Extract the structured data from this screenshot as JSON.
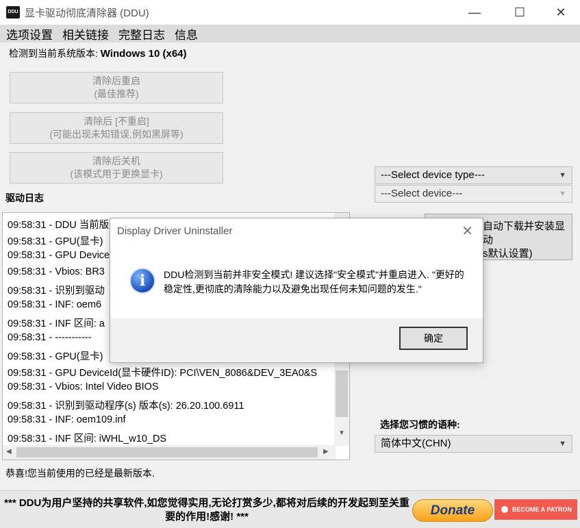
{
  "window": {
    "title": "显卡驱动彻底清除器 (DDU)",
    "app_icon_text": "DDU",
    "minimize": "—",
    "maximize": "☐",
    "close": "✕"
  },
  "menu": [
    "选项设置",
    "相关链接",
    "完整日志",
    "信息"
  ],
  "system": {
    "label": "检测到当前系统版本: ",
    "version": "Windows 10 (x64)"
  },
  "actions": [
    {
      "line1": "清除后重启",
      "line2": "(最佳推荐)"
    },
    {
      "line1": "清除后 [不重启]",
      "line2": "(可能出现未知错误,例如黑屏等)"
    },
    {
      "line1": "清除后关机",
      "line2": "(该模式用于更换显卡)"
    }
  ],
  "log": {
    "label": "驱动日志",
    "lines": [
      "09:58:31 - DDU 当前版",
      "09:58:31 - GPU(显卡)",
      "09:58:31 - GPU Device",
      "09:58:31 - Vbios: BR3",
      "09:58:31 - 识别到驱动",
      "09:58:31 - INF: oem6",
      "09:58:31 - INF 区间: a",
      "09:58:31 - -----------",
      "09:58:31 - GPU(显卡)",
      "09:58:31 - GPU DeviceId(显卡硬件ID): PCI\\VEN_8086&DEV_3EA0&S",
      "09:58:31 - Vbios: Intel Video BIOS",
      "09:58:31 - 识别到驱动程序(s) 版本(s): 26.20.100.6911",
      "09:58:31 - INF: oem109.inf",
      "09:58:31 - INF 区间: iWHL_w10_DS"
    ]
  },
  "status_message": "恭喜!您当前使用的已经是最新版本.",
  "device_type_select": "---Select device type---",
  "device_select": "---Select device---",
  "right_button": {
    "line1": "自动下载并安装显",
    "line2": "动",
    "line3": "s默认设置)"
  },
  "language": {
    "label": "选择您习惯的语种:",
    "value": "简体中文(CHN)"
  },
  "footer": {
    "text": "*** DDU为用户坚持的共享软件,如您觉得实用,无论打赏多少,都将对后续的开发起到至关重要的作用!感谢! ***",
    "donate": "Donate",
    "patron": "BECOME A PATRON"
  },
  "dialog": {
    "title": "Display Driver Uninstaller",
    "close": "✕",
    "icon": "i",
    "message": "DDU检测到当前并非安全模式!  建议选择\"安全模式\"并重启进入. \"更好的稳定性,更彻底的清除能力以及避免出现任何未知问题的发生.\"",
    "ok": "确定"
  }
}
